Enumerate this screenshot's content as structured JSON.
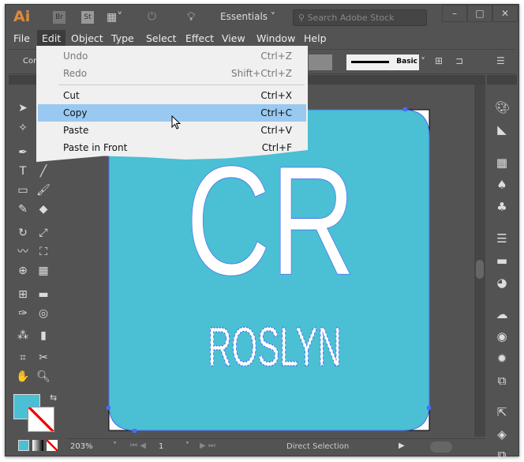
{
  "app": {
    "logo": "Ai",
    "bridge": "Br",
    "stock": "St",
    "workspace": "Essentials",
    "search_placeholder": "Search Adobe Stock",
    "min": "–",
    "max": "□",
    "close": "✕"
  },
  "menubar": [
    "File",
    "Edit",
    "Object",
    "Type",
    "Select",
    "Effect",
    "View",
    "Window",
    "Help"
  ],
  "control": {
    "left_label": "Com",
    "stroke_style": "Basic"
  },
  "edit_menu": [
    {
      "label": "Undo",
      "shortcut": "Ctrl+Z",
      "disabled": true
    },
    {
      "label": "Redo",
      "shortcut": "Shift+Ctrl+Z",
      "disabled": true
    },
    {
      "label": "Cut",
      "shortcut": "Ctrl+X"
    },
    {
      "label": "Copy",
      "shortcut": "Ctrl+C",
      "highlighted": true
    },
    {
      "label": "Paste",
      "shortcut": "Ctrl+V"
    },
    {
      "label": "Paste in Front",
      "shortcut": "Ctrl+F"
    }
  ],
  "artwork": {
    "title": "CR",
    "subtitle": "ROSLYN",
    "bg": "#4bbfd3"
  },
  "status": {
    "zoom": "203%",
    "artboard": "1",
    "tool": "Direct Selection"
  },
  "colors": {
    "fill": "#4bbfd3",
    "selection": "#4a6cf7"
  }
}
